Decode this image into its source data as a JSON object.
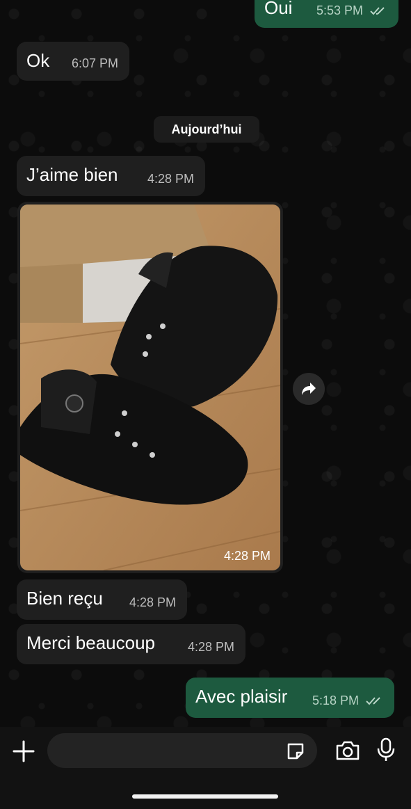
{
  "messages": [
    {
      "text": "Oui",
      "time": "5:53 PM",
      "direction": "out",
      "status": "read"
    },
    {
      "text": "Ok",
      "time": "6:07 PM",
      "direction": "in"
    },
    {
      "text": "J’aime bien",
      "time": "4:28 PM",
      "direction": "in"
    },
    {
      "text": "",
      "image": "black sneakers on wooden floor",
      "time": "4:28 PM",
      "direction": "in"
    },
    {
      "text": "Bien reçu",
      "time": "4:28 PM",
      "direction": "in"
    },
    {
      "text": "Merci beaucoup",
      "time": "4:28 PM",
      "direction": "in"
    },
    {
      "text": "Avec plaisir",
      "time": "5:18 PM",
      "direction": "out",
      "status": "read"
    }
  ],
  "date_divider": "Aujourd’hui",
  "icons": {
    "forward": "forward-icon",
    "attach": "plus-icon",
    "sticker": "sticker-icon",
    "camera": "camera-icon",
    "mic": "microphone-icon"
  },
  "colors": {
    "incoming_bubble": "#1f1f1f",
    "outgoing_bubble": "#1d5a3f",
    "background": "#0b0b0b"
  }
}
